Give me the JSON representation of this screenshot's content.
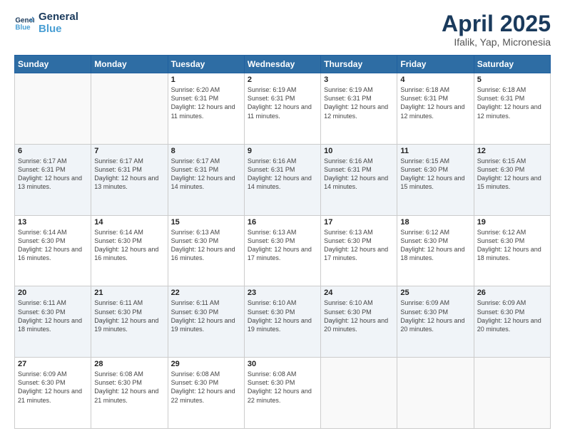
{
  "header": {
    "logo_general": "General",
    "logo_blue": "Blue",
    "month_title": "April 2025",
    "location": "Ifalik, Yap, Micronesia"
  },
  "days_of_week": [
    "Sunday",
    "Monday",
    "Tuesday",
    "Wednesday",
    "Thursday",
    "Friday",
    "Saturday"
  ],
  "weeks": [
    [
      {
        "day": "",
        "info": ""
      },
      {
        "day": "",
        "info": ""
      },
      {
        "day": "1",
        "info": "Sunrise: 6:20 AM\nSunset: 6:31 PM\nDaylight: 12 hours and 11 minutes."
      },
      {
        "day": "2",
        "info": "Sunrise: 6:19 AM\nSunset: 6:31 PM\nDaylight: 12 hours and 11 minutes."
      },
      {
        "day": "3",
        "info": "Sunrise: 6:19 AM\nSunset: 6:31 PM\nDaylight: 12 hours and 12 minutes."
      },
      {
        "day": "4",
        "info": "Sunrise: 6:18 AM\nSunset: 6:31 PM\nDaylight: 12 hours and 12 minutes."
      },
      {
        "day": "5",
        "info": "Sunrise: 6:18 AM\nSunset: 6:31 PM\nDaylight: 12 hours and 12 minutes."
      }
    ],
    [
      {
        "day": "6",
        "info": "Sunrise: 6:17 AM\nSunset: 6:31 PM\nDaylight: 12 hours and 13 minutes."
      },
      {
        "day": "7",
        "info": "Sunrise: 6:17 AM\nSunset: 6:31 PM\nDaylight: 12 hours and 13 minutes."
      },
      {
        "day": "8",
        "info": "Sunrise: 6:17 AM\nSunset: 6:31 PM\nDaylight: 12 hours and 14 minutes."
      },
      {
        "day": "9",
        "info": "Sunrise: 6:16 AM\nSunset: 6:31 PM\nDaylight: 12 hours and 14 minutes."
      },
      {
        "day": "10",
        "info": "Sunrise: 6:16 AM\nSunset: 6:31 PM\nDaylight: 12 hours and 14 minutes."
      },
      {
        "day": "11",
        "info": "Sunrise: 6:15 AM\nSunset: 6:30 PM\nDaylight: 12 hours and 15 minutes."
      },
      {
        "day": "12",
        "info": "Sunrise: 6:15 AM\nSunset: 6:30 PM\nDaylight: 12 hours and 15 minutes."
      }
    ],
    [
      {
        "day": "13",
        "info": "Sunrise: 6:14 AM\nSunset: 6:30 PM\nDaylight: 12 hours and 16 minutes."
      },
      {
        "day": "14",
        "info": "Sunrise: 6:14 AM\nSunset: 6:30 PM\nDaylight: 12 hours and 16 minutes."
      },
      {
        "day": "15",
        "info": "Sunrise: 6:13 AM\nSunset: 6:30 PM\nDaylight: 12 hours and 16 minutes."
      },
      {
        "day": "16",
        "info": "Sunrise: 6:13 AM\nSunset: 6:30 PM\nDaylight: 12 hours and 17 minutes."
      },
      {
        "day": "17",
        "info": "Sunrise: 6:13 AM\nSunset: 6:30 PM\nDaylight: 12 hours and 17 minutes."
      },
      {
        "day": "18",
        "info": "Sunrise: 6:12 AM\nSunset: 6:30 PM\nDaylight: 12 hours and 18 minutes."
      },
      {
        "day": "19",
        "info": "Sunrise: 6:12 AM\nSunset: 6:30 PM\nDaylight: 12 hours and 18 minutes."
      }
    ],
    [
      {
        "day": "20",
        "info": "Sunrise: 6:11 AM\nSunset: 6:30 PM\nDaylight: 12 hours and 18 minutes."
      },
      {
        "day": "21",
        "info": "Sunrise: 6:11 AM\nSunset: 6:30 PM\nDaylight: 12 hours and 19 minutes."
      },
      {
        "day": "22",
        "info": "Sunrise: 6:11 AM\nSunset: 6:30 PM\nDaylight: 12 hours and 19 minutes."
      },
      {
        "day": "23",
        "info": "Sunrise: 6:10 AM\nSunset: 6:30 PM\nDaylight: 12 hours and 19 minutes."
      },
      {
        "day": "24",
        "info": "Sunrise: 6:10 AM\nSunset: 6:30 PM\nDaylight: 12 hours and 20 minutes."
      },
      {
        "day": "25",
        "info": "Sunrise: 6:09 AM\nSunset: 6:30 PM\nDaylight: 12 hours and 20 minutes."
      },
      {
        "day": "26",
        "info": "Sunrise: 6:09 AM\nSunset: 6:30 PM\nDaylight: 12 hours and 20 minutes."
      }
    ],
    [
      {
        "day": "27",
        "info": "Sunrise: 6:09 AM\nSunset: 6:30 PM\nDaylight: 12 hours and 21 minutes."
      },
      {
        "day": "28",
        "info": "Sunrise: 6:08 AM\nSunset: 6:30 PM\nDaylight: 12 hours and 21 minutes."
      },
      {
        "day": "29",
        "info": "Sunrise: 6:08 AM\nSunset: 6:30 PM\nDaylight: 12 hours and 22 minutes."
      },
      {
        "day": "30",
        "info": "Sunrise: 6:08 AM\nSunset: 6:30 PM\nDaylight: 12 hours and 22 minutes."
      },
      {
        "day": "",
        "info": ""
      },
      {
        "day": "",
        "info": ""
      },
      {
        "day": "",
        "info": ""
      }
    ]
  ]
}
